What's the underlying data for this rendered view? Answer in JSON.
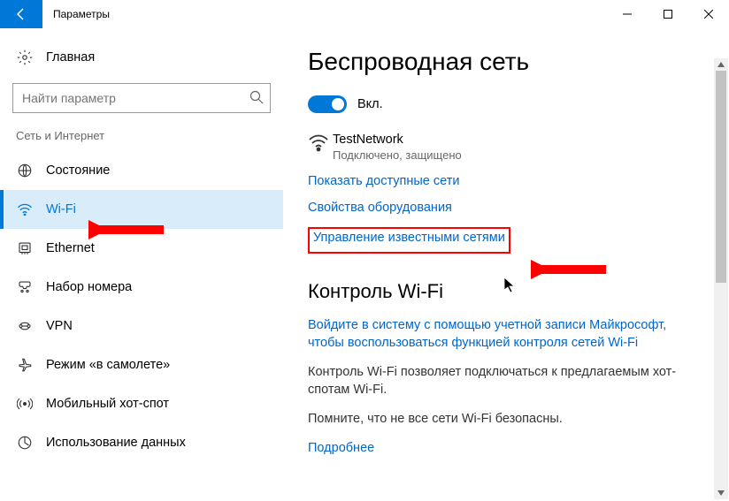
{
  "titlebar": {
    "title": "Параметры"
  },
  "sidebar": {
    "home": "Главная",
    "search_placeholder": "Найти параметр",
    "section": "Сеть и Интернет",
    "items": [
      {
        "label": "Состояние"
      },
      {
        "label": "Wi-Fi"
      },
      {
        "label": "Ethernet"
      },
      {
        "label": "Набор номера"
      },
      {
        "label": "VPN"
      },
      {
        "label": "Режим «в самолете»"
      },
      {
        "label": "Мобильный хот-спот"
      },
      {
        "label": "Использование данных"
      }
    ]
  },
  "main": {
    "heading": "Беспроводная сеть",
    "toggle_label": "Вкл.",
    "network": {
      "name": "TestNetwork",
      "status": "Подключено, защищено"
    },
    "link_show": "Показать доступные сети",
    "link_hw": "Свойства оборудования",
    "link_known": "Управление известными сетями",
    "section2": "Контроль Wi-Fi",
    "signin": "Войдите в систему с помощью учетной записи Майкрософт, чтобы воспользоваться функцией контроля сетей Wi-Fi",
    "desc": "Контроль Wi-Fi позволяет подключаться к предлагаемым хот-спотам Wi-Fi.",
    "warn": "Помните, что не все сети Wi-Fi безопасны.",
    "more": "Подробнее"
  }
}
